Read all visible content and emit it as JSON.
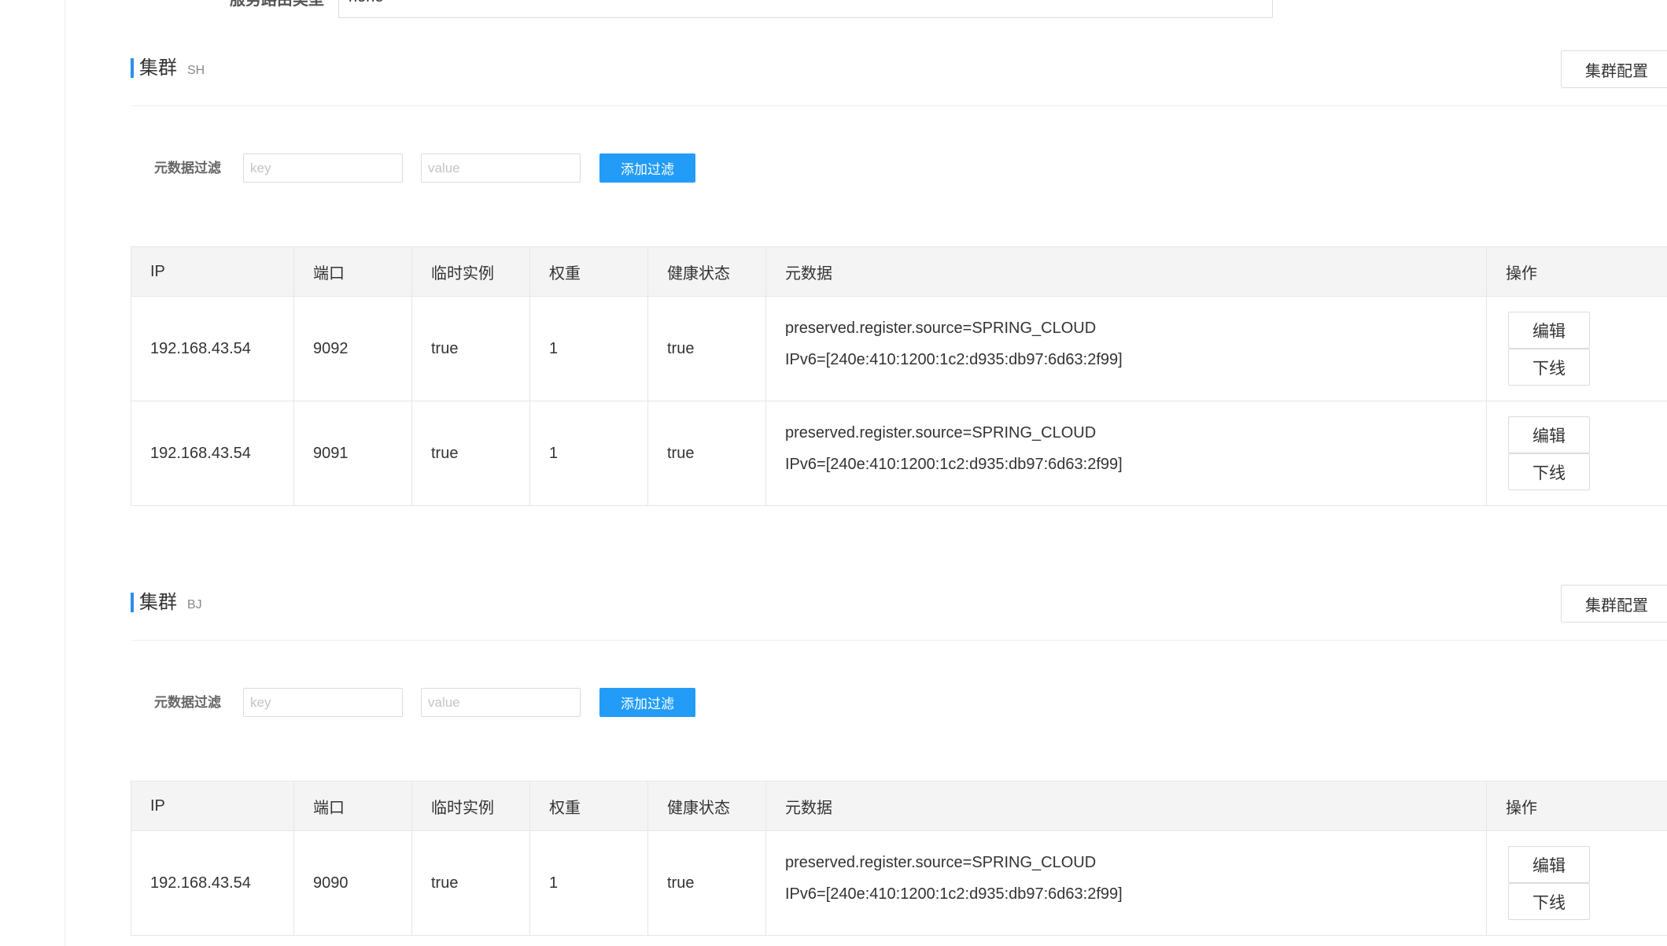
{
  "service": {
    "route_type_label": "服务路由类型",
    "route_type_value": "none"
  },
  "colors": {
    "accent": "#2a8ff0",
    "primary_button": "#239cf7",
    "header_bg": "#f4f4f4",
    "border": "#e6e6e6"
  },
  "clusters": [
    {
      "title": "集群",
      "name": "SH",
      "config_button": "集群配置",
      "filter": {
        "label": "元数据过滤",
        "key_placeholder": "key",
        "value_placeholder": "value",
        "add_button": "添加过滤"
      },
      "columns": [
        "IP",
        "端口",
        "临时实例",
        "权重",
        "健康状态",
        "元数据",
        "操作"
      ],
      "rows": [
        {
          "ip": "192.168.43.54",
          "port": "9092",
          "ephemeral": "true",
          "weight": "1",
          "healthy": "true",
          "metadata": [
            "preserved.register.source=SPRING_CLOUD",
            "IPv6=[240e:410:1200:1c2:d935:db97:6d63:2f99]"
          ],
          "actions": {
            "edit": "编辑",
            "offline": "下线"
          }
        },
        {
          "ip": "192.168.43.54",
          "port": "9091",
          "ephemeral": "true",
          "weight": "1",
          "healthy": "true",
          "metadata": [
            "preserved.register.source=SPRING_CLOUD",
            "IPv6=[240e:410:1200:1c2:d935:db97:6d63:2f99]"
          ],
          "actions": {
            "edit": "编辑",
            "offline": "下线"
          }
        }
      ]
    },
    {
      "title": "集群",
      "name": "BJ",
      "config_button": "集群配置",
      "filter": {
        "label": "元数据过滤",
        "key_placeholder": "key",
        "value_placeholder": "value",
        "add_button": "添加过滤"
      },
      "columns": [
        "IP",
        "端口",
        "临时实例",
        "权重",
        "健康状态",
        "元数据",
        "操作"
      ],
      "rows": [
        {
          "ip": "192.168.43.54",
          "port": "9090",
          "ephemeral": "true",
          "weight": "1",
          "healthy": "true",
          "metadata": [
            "preserved.register.source=SPRING_CLOUD",
            "IPv6=[240e:410:1200:1c2:d935:db97:6d63:2f99]"
          ],
          "actions": {
            "edit": "编辑",
            "offline": "下线"
          }
        }
      ]
    }
  ]
}
